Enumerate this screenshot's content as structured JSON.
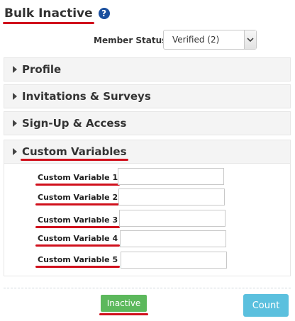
{
  "header": {
    "title": "Bulk Inactive",
    "help_icon": "?"
  },
  "filter": {
    "label": "Member Status",
    "selected": "Verified (2)"
  },
  "sections": [
    {
      "label": "Profile",
      "expanded": false
    },
    {
      "label": "Invitations & Surveys",
      "expanded": false
    },
    {
      "label": "Sign-Up & Access",
      "expanded": false
    },
    {
      "label": "Custom Variables",
      "expanded": true
    }
  ],
  "custom_variables": [
    {
      "label": "Custom Variable 1",
      "value": ""
    },
    {
      "label": "Custom Variable 2",
      "value": ""
    },
    {
      "label": "Custom Variable 3",
      "value": ""
    },
    {
      "label": "Custom Variable 4",
      "value": ""
    },
    {
      "label": "Custom Variable 5",
      "value": ""
    }
  ],
  "buttons": {
    "inactive": "Inactive",
    "count": "Count"
  },
  "colors": {
    "inactive_button": "#5cb85c",
    "count_button": "#5bc0de",
    "annotation_underline": "#d0101c",
    "help_icon": "#1a4f9e"
  }
}
